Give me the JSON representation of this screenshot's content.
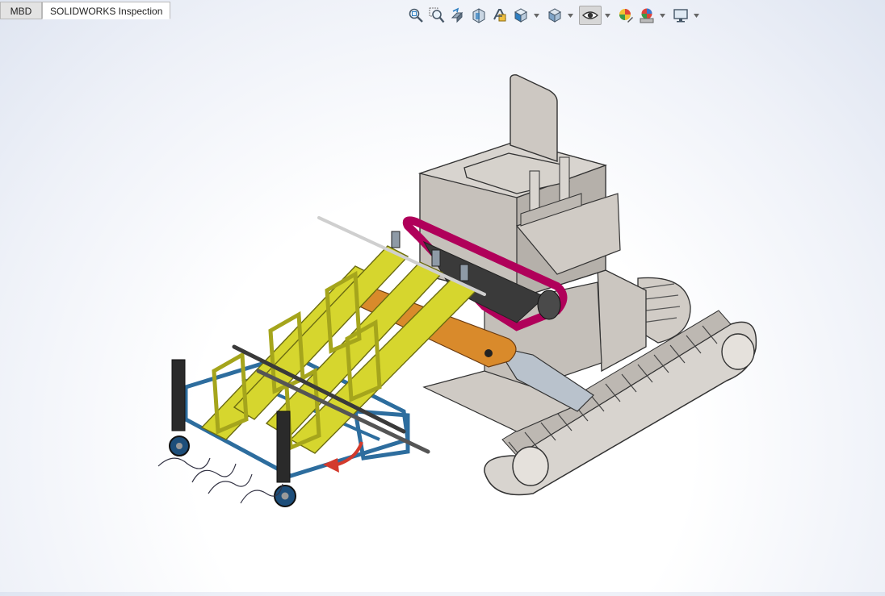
{
  "tabs": [
    {
      "label": "MBD",
      "active": false
    },
    {
      "label": "SOLIDWORKS Inspection",
      "active": true
    }
  ],
  "toolbar": {
    "icons": [
      "zoom-to-fit-icon",
      "zoom-to-area-icon",
      "previous-view-icon",
      "section-view-icon",
      "dynamic-annotation-views-icon",
      "view-orientation-icon",
      "display-style-icon",
      "hide-show-items-icon",
      "edit-appearance-icon",
      "apply-scene-icon",
      "view-settings-icon"
    ]
  },
  "model": {
    "description": "Tracked vehicle with inclined conveyor and front wheel attachment",
    "colors": {
      "chassis": "#c8c3bd",
      "conveyor_frame": "#d6d62e",
      "belt": "#b0005a",
      "base_frame": "#2d6d9e",
      "bracket": "#d98a2b",
      "arrow": "#d33a2c",
      "wheel": "#1d4e7a"
    }
  }
}
